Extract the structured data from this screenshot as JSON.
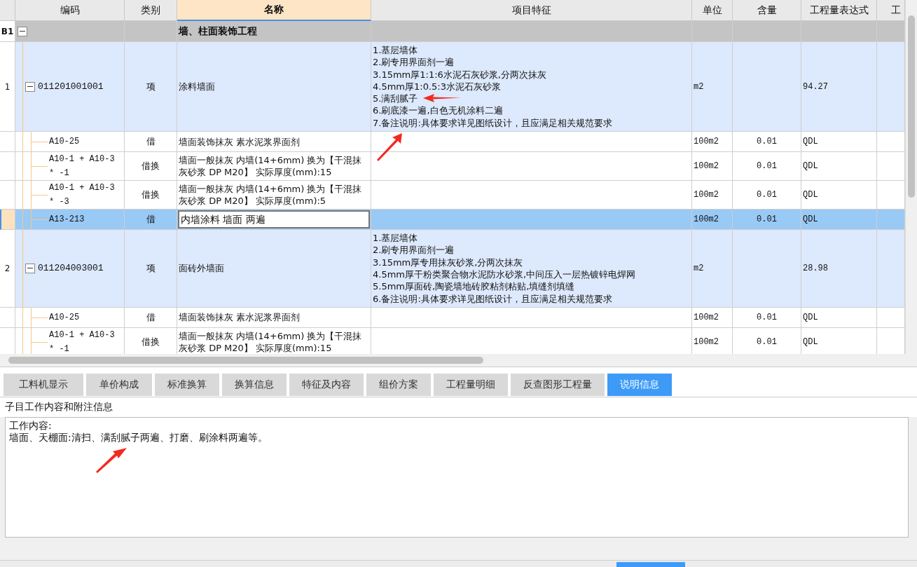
{
  "table": {
    "columns": [
      {
        "selected": false
      },
      {
        "label": "编码",
        "selected": false
      },
      {
        "label": "类别",
        "selected": false
      },
      {
        "label": "名称",
        "selected": true
      },
      {
        "label": "项目特征",
        "selected": false
      },
      {
        "label": "单位",
        "selected": false
      },
      {
        "label": "含量",
        "selected": false
      },
      {
        "label": "工程量表达式",
        "selected": false
      },
      {
        "label": "工",
        "selected": false
      }
    ],
    "rows": [
      {
        "kind": "section",
        "number": "B1",
        "name": "墙、柱面装饰工程",
        "expanded": true,
        "selected": false,
        "children": [
          {
            "kind": "item",
            "number": "1",
            "code": "011201001001",
            "type": "项",
            "name": "涂料墙面",
            "features": [
              "1.基层墙体",
              "2.刷专用界面剂一遍",
              "3.15mm厚1:1:6水泥石灰砂浆,分两次抹灰",
              "4.5mm厚1:0.5:3水泥石灰砂浆",
              "5.满刮腻子",
              "6.刷底漆一遍,白色无机涂料二遍",
              "7.备注说明:具体要求详见图纸设计，且应满足相关规范要求"
            ],
            "unit": "m2",
            "expr": "94.27",
            "expanded": true,
            "selected": false,
            "children": [
              {
                "kind": "sub",
                "code": "A10-25",
                "type": "借",
                "name": "墙面装饰抹灰 素水泥浆界面剂",
                "unit": "100m2",
                "qty": "0.01",
                "expr": "QDL",
                "selected": false
              },
              {
                "kind": "sub",
                "code": "A10-1 + A10-3 * -1",
                "type": "借换",
                "name": "墙面一般抹灰 内墙(14+6mm)  换为【干混抹灰砂浆 DP M20】  实际厚度(mm):15",
                "unit": "100m2",
                "qty": "0.01",
                "expr": "QDL",
                "selected": false
              },
              {
                "kind": "sub",
                "code": "A10-1 + A10-3 * -3",
                "type": "借换",
                "name": "墙面一般抹灰 内墙(14+6mm)  换为【干混抹灰砂浆 DP M20】  实际厚度(mm):5",
                "unit": "100m2",
                "qty": "0.01",
                "expr": "QDL",
                "selected": false
              },
              {
                "kind": "sub",
                "code": "A13-213",
                "type": "借",
                "name": "内墙涂料 墙面 两遍",
                "unit": "100m2",
                "qty": "0.01",
                "expr": "QDL",
                "selected": true
              }
            ]
          },
          {
            "kind": "item",
            "number": "2",
            "code": "011204003001",
            "type": "项",
            "name": "面砖外墙面",
            "features": [
              "1.基层墙体",
              "2.刷专用界面剂一遍",
              "3.15mm厚专用抹灰砂浆,分两次抹灰",
              "4.5mm厚干粉类聚合物水泥防水砂浆,中间压入一层热镀锌电焊网",
              "5.5mm厚面砖,陶瓷墙地砖胶粘剂粘贴,填缝剂填缝",
              "6.备注说明:具体要求详见图纸设计，且应满足相关规范要求"
            ],
            "unit": "m2",
            "expr": "28.98",
            "expanded": true,
            "selected": false,
            "children": [
              {
                "kind": "sub",
                "code": "A10-25",
                "type": "借",
                "name": "墙面装饰抹灰 素水泥浆界面剂",
                "unit": "100m2",
                "qty": "0.01",
                "expr": "QDL",
                "selected": false
              },
              {
                "kind": "sub",
                "code": "A10-1 + A10-3 * -1",
                "type": "借换",
                "name": "墙面一般抹灰 内墙(14+6mm)  换为【干混抹灰砂浆 DP M20】  实际厚度(mm):15",
                "unit": "100m2",
                "qty": "0.01",
                "expr": "QDL",
                "selected": false
              }
            ]
          }
        ]
      }
    ]
  },
  "tabs": [
    {
      "label": "工料机显示",
      "selected": false
    },
    {
      "label": "单价构成",
      "selected": false
    },
    {
      "label": "标准换算",
      "selected": false
    },
    {
      "label": "换算信息",
      "selected": false
    },
    {
      "label": "特征及内容",
      "selected": false
    },
    {
      "label": "组价方案",
      "selected": false
    },
    {
      "label": "工程量明细",
      "selected": false
    },
    {
      "label": "反查图形工程量",
      "selected": false
    },
    {
      "label": "说明信息",
      "selected": true
    }
  ],
  "info": {
    "title": "子目工作内容和附注信息",
    "lines": [
      "工作内容:",
      "墙面、天棚面:清扫、满刮腻子两遍、打磨、刷涂料两遍等。"
    ]
  }
}
